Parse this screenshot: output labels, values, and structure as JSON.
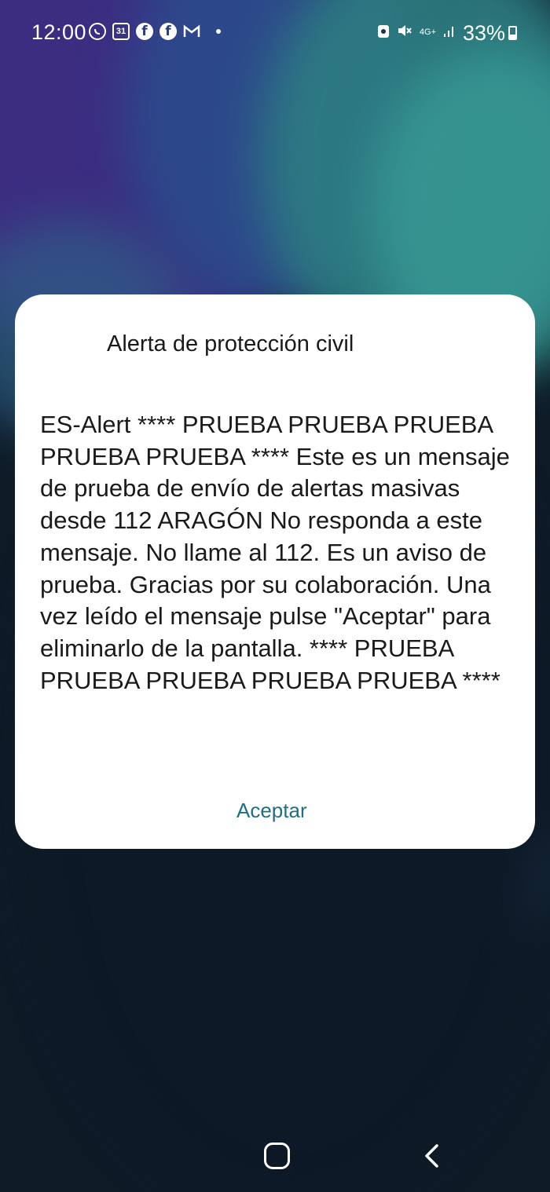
{
  "status_bar": {
    "time": "12:00",
    "notification_icons": [
      "whatsapp-icon",
      "calendar-icon",
      "facebook-icon",
      "facebook-icon",
      "gmail-icon",
      "dot-icon"
    ],
    "calendar_day": "31",
    "network_label": "4G+",
    "battery": "33%"
  },
  "dialog": {
    "title": "Alerta de protección civil",
    "message": "ES-Alert **** PRUEBA PRUEBA PRUEBA PRUEBA PRUEBA **** Este es un mensaje de prueba de envío de alertas masivas desde 112 ARAGÓN No responda a este mensaje. No llame al 112. Es un aviso de prueba. Gracias por su colaboración. Una vez leído el mensaje pulse \"Aceptar\" para eliminarlo de la pantalla. **** PRUEBA PRUEBA PRUEBA PRUEBA PRUEBA ****",
    "accept_label": "Aceptar"
  },
  "colors": {
    "accent": "#1f6f83",
    "dialog_bg": "#ffffff"
  },
  "nav_bar": {
    "icons": [
      "home-icon",
      "back-icon"
    ]
  }
}
